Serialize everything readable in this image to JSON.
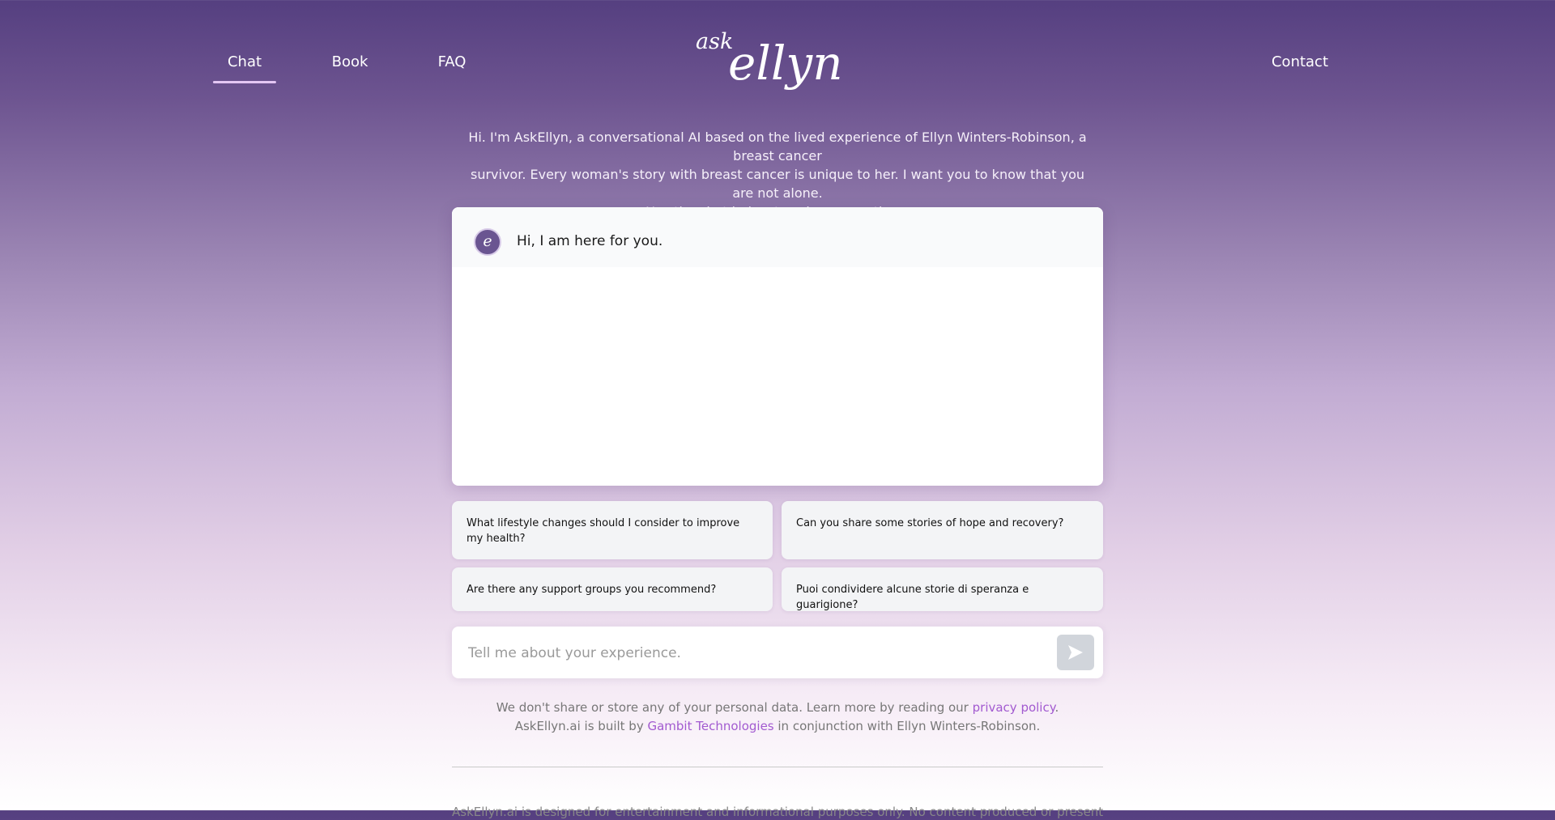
{
  "nav": {
    "items": [
      "Chat",
      "Book",
      "FAQ"
    ],
    "contact": "Contact",
    "logo_small": "ask",
    "logo_script": "ellyn"
  },
  "intro": {
    "line1": "Hi. I'm AskEllyn, a conversational AI based on the lived experience of Ellyn Winters-Robinson, a breast cancer",
    "line2": "survivor. Every woman's story with breast cancer is unique to her. I want you to know that you are not alone.",
    "line3": "Use the chat below to ask me questions."
  },
  "chat": {
    "avatar_letter": "e",
    "message": "Hi, I am here for you."
  },
  "suggestions": [
    "What lifestyle changes should I consider to improve my health?",
    "Can you share some stories of hope and recovery?",
    "Are there any support groups you recommend?",
    "Puoi condividere alcune storie di speranza e guarigione?"
  ],
  "input": {
    "placeholder": "Tell me about your experience."
  },
  "footer": {
    "privacy_before": "We don't share or store any of your personal data. Learn more by reading our ",
    "privacy_link": "privacy policy",
    "privacy_after": ".",
    "built_before": "AskEllyn.ai is built by ",
    "built_link": "Gambit Technologies",
    "built_after": " in conjunction with Ellyn Winters-Robinson.",
    "disclaimer": "AskEllyn.ai is designed for entertainment and informational purposes only. No content produced or presented on a"
  },
  "colors": {
    "accent_link": "#a25ad0",
    "nav_underline": "#e3c6f3",
    "avatar_bg": "#6a5591",
    "send_button_bg": "#d1d5db"
  }
}
